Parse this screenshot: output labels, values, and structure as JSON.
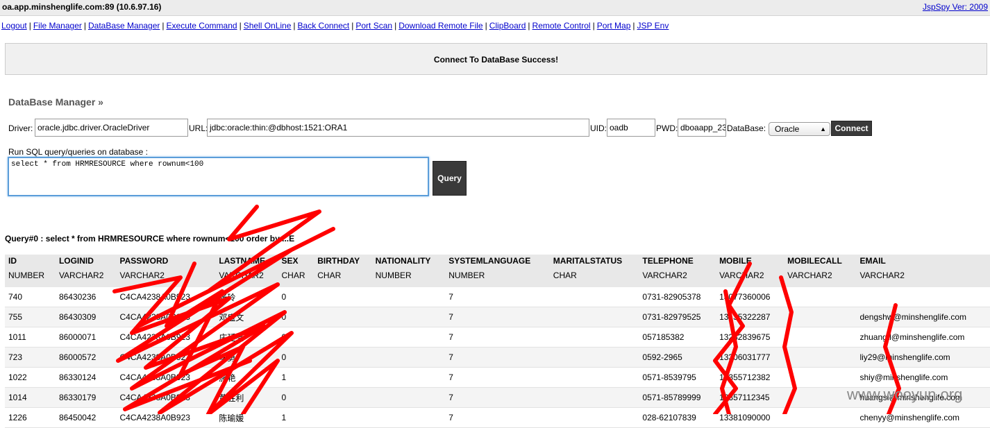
{
  "header": {
    "host": "oa.app.minshenglife.com:89 (10.6.97.16)",
    "version": "JspSpy Ver: 2009"
  },
  "nav": [
    "Logout",
    "File Manager",
    "DataBase Manager",
    "Execute Command",
    "Shell OnLine",
    "Back Connect",
    "Port Scan",
    "Download Remote File",
    "ClipBoard",
    "Remote Control",
    "Port Map",
    "JSP Env"
  ],
  "message": "Connect To DataBase Success!",
  "db": {
    "title": "DataBase Manager »",
    "driver_label": "Driver:",
    "driver_value": "oracle.jdbc.driver.OracleDriver",
    "url_label": "URL:",
    "url_value": "jdbc:oracle:thin:@dbhost:1521:ORA1",
    "uid_label": "UID:",
    "uid_value": "oadb",
    "pwd_label": "PWD:",
    "pwd_value": "dboaapp_23",
    "database_label": "DataBase:",
    "database_value": "Oracle",
    "connect_label": "Connect",
    "sql_label": "Run SQL query/queries on database :",
    "sql_value": "select * from HRMRESOURCE where rownum<100",
    "query_label": "Query"
  },
  "result": {
    "query_text": "Query#0 : select * from HRMRESOURCE where rownum<100 order by ...E",
    "columns": [
      {
        "name": "ID",
        "type": "NUMBER"
      },
      {
        "name": "LOGINID",
        "type": "VARCHAR2"
      },
      {
        "name": "PASSWORD",
        "type": "VARCHAR2"
      },
      {
        "name": "",
        "type": ""
      },
      {
        "name": "LASTNAME",
        "type": "VARCHAR2"
      },
      {
        "name": "SEX",
        "type": "CHAR"
      },
      {
        "name": "BIRTHDAY",
        "type": "CHAR"
      },
      {
        "name": "NATIONALITY",
        "type": "NUMBER"
      },
      {
        "name": "SYSTEMLANGUAGE",
        "type": "NUMBER"
      },
      {
        "name": "MARITALSTATUS",
        "type": "CHAR"
      },
      {
        "name": "TELEPHONE",
        "type": "VARCHAR2"
      },
      {
        "name": "MOBILE",
        "type": "VARCHAR2"
      },
      {
        "name": "MOBILECALL",
        "type": "VARCHAR2"
      },
      {
        "name": "EMAIL",
        "type": "VARCHAR2"
      }
    ],
    "rows": [
      [
        "740",
        "86430236",
        "C4CA4238A0B923",
        "",
        "张玲",
        "0",
        "",
        "",
        "7",
        "",
        "0731-82905378",
        "13077360006",
        "",
        ""
      ],
      [
        "755",
        "86430309",
        "C4CA4238A0B923",
        "",
        "邓盛文",
        "0",
        "",
        "",
        "7",
        "",
        "0731-82979525",
        "13135322287",
        "",
        "dengshw@minshenglife.com"
      ],
      [
        "1011",
        "86000071",
        "C4CA4238A0B923",
        "",
        "庄廷亮",
        "0",
        "",
        "",
        "7",
        "",
        "057185382",
        "13282839675",
        "",
        "zhuangtl@minshenglife.com"
      ],
      [
        "723",
        "86000572",
        "C4CA4238A0B923",
        "",
        "李勇",
        "0",
        "",
        "",
        "7",
        "",
        "0592-2965",
        "13306031777",
        "",
        "liy29@minshenglife.com"
      ],
      [
        "1022",
        "86330124",
        "C4CA4238A0B923",
        "",
        "施艳",
        "1",
        "",
        "",
        "7",
        "",
        "0571-8539795",
        "13355712382",
        "",
        "shiy@minshenglife.com"
      ],
      [
        "1014",
        "86330179",
        "C4CA4238A0B923",
        "",
        "黄胜利",
        "0",
        "",
        "",
        "7",
        "",
        "0571-85789999",
        "13357112345",
        "",
        "huangsl@minshenglife.com"
      ],
      [
        "1226",
        "86450042",
        "C4CA4238A0B923",
        "",
        "陈瑜媛",
        "1",
        "",
        "",
        "7",
        "",
        "028-62107839",
        "13381090000",
        "",
        "chenyy@minshenglife.com"
      ]
    ]
  },
  "watermark": "www.wooyun.org"
}
